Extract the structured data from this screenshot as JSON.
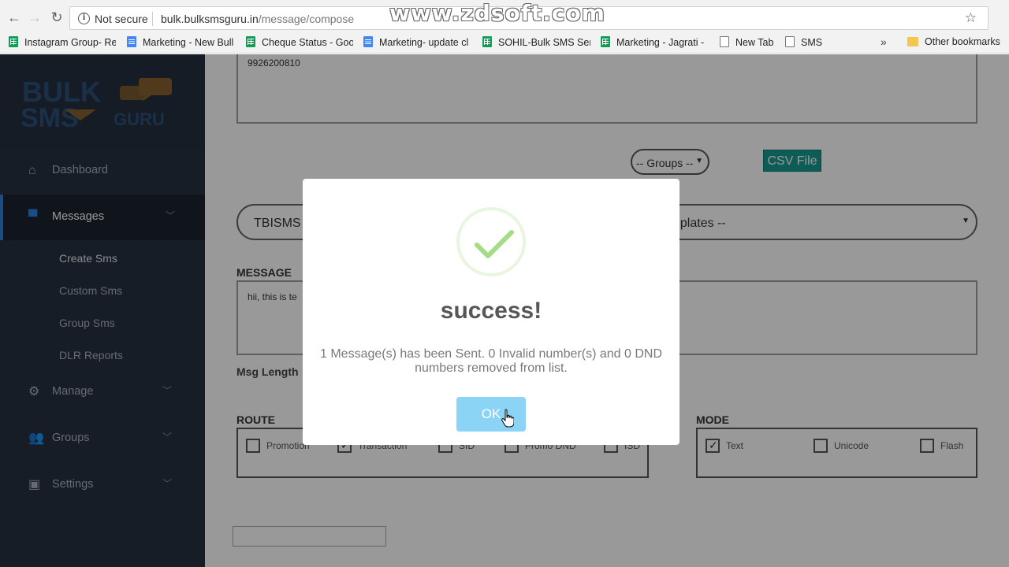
{
  "browser": {
    "not_secure_label": "Not secure",
    "url_host": "bulk.bulksmsguru.in",
    "url_path": "/message/compose",
    "watermark": "www.zdsoft.com",
    "bookmarks": [
      {
        "label": "Instagram Group- Re",
        "icon": "sheet"
      },
      {
        "label": "Marketing - New Bull",
        "icon": "doc"
      },
      {
        "label": "Cheque Status - Goo",
        "icon": "sheet"
      },
      {
        "label": "Marketing- update cl",
        "icon": "doc"
      },
      {
        "label": "SOHIL-Bulk SMS Sent",
        "icon": "sheet"
      },
      {
        "label": "Marketing - Jagrati -",
        "icon": "sheet"
      },
      {
        "label": "New Tab",
        "icon": "page"
      },
      {
        "label": "SMS",
        "icon": "page"
      }
    ],
    "more_label": "»",
    "other_bookmarks": "Other bookmarks"
  },
  "sidebar": {
    "logo_text": "BULK SMS GURU",
    "items": [
      {
        "label": "Dashboard",
        "icon": "home-icon"
      },
      {
        "label": "Messages",
        "icon": "chat-icon"
      },
      {
        "label": "Manage",
        "icon": "gear-icon"
      },
      {
        "label": "Groups",
        "icon": "users-icon"
      },
      {
        "label": "Settings",
        "icon": "settings-icon"
      }
    ],
    "sub_items": [
      "Create Sms",
      "Custom Sms",
      "Group Sms",
      "DLR Reports"
    ]
  },
  "form": {
    "numbers_value": "9926200810",
    "groups_select": "-- Groups --",
    "csv_button": "CSV File",
    "sender_value": "TBISMS",
    "templates_value": "nplates --",
    "message_label": "MESSAGE",
    "message_value": "hii, this is te",
    "msg_length_label": "Msg Length",
    "route_label": "ROUTE",
    "route_options": [
      {
        "label": "Promotion",
        "checked": false
      },
      {
        "label": "Transaction",
        "checked": true
      },
      {
        "label": "SID",
        "checked": false
      },
      {
        "label": "Promo DND",
        "checked": false
      },
      {
        "label": "ISD",
        "checked": false
      }
    ],
    "mode_label": "MODE",
    "mode_options": [
      {
        "label": "Text",
        "checked": true
      },
      {
        "label": "Unicode",
        "checked": false
      },
      {
        "label": "Flash",
        "checked": false
      }
    ]
  },
  "modal": {
    "title": "success!",
    "text": "1 Message(s) has been Sent. 0 Invalid number(s) and 0 DND numbers removed from list.",
    "ok_label": "OK",
    "accent_color": "#a5dc86",
    "button_color": "#8cd4f5"
  }
}
